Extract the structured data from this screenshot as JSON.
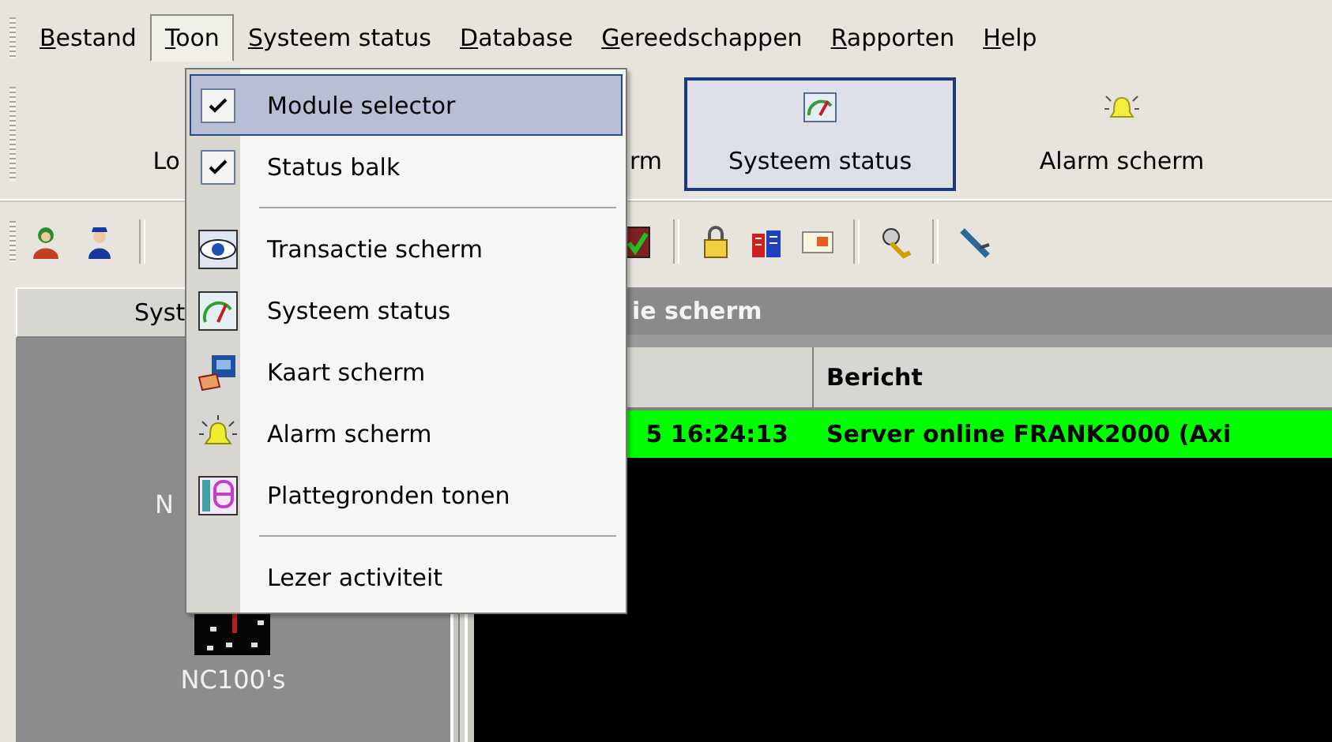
{
  "menu_bar": [
    {
      "label": "Bestand",
      "selected": false
    },
    {
      "label": "Toon",
      "selected": true
    },
    {
      "label": "Systeem status",
      "selected": false
    },
    {
      "label": "Database",
      "selected": false
    },
    {
      "label": "Gereedschappen",
      "selected": false
    },
    {
      "label": "Rapporten",
      "selected": false
    },
    {
      "label": "Help",
      "selected": false
    }
  ],
  "dropdown": [
    {
      "kind": "item",
      "label": "Module selector",
      "checked": true,
      "selected": true
    },
    {
      "kind": "item",
      "label": "Status balk",
      "checked": true,
      "selected": false
    },
    {
      "kind": "separator"
    },
    {
      "kind": "item",
      "label": "Transactie scherm",
      "checked": false,
      "selected": false
    },
    {
      "kind": "item",
      "label": "Systeem status",
      "checked": false,
      "selected": false
    },
    {
      "kind": "item",
      "label": "Kaart scherm",
      "checked": false,
      "selected": false
    },
    {
      "kind": "item",
      "label": "Alarm scherm",
      "checked": false,
      "selected": false
    },
    {
      "kind": "item",
      "label": "Plattegronden tonen",
      "checked": false,
      "selected": false
    },
    {
      "kind": "separator"
    },
    {
      "kind": "item",
      "label": "Lezer activiteit",
      "checked": false,
      "selected": false
    }
  ],
  "module_bar": [
    {
      "label": "Lo",
      "selected": false
    },
    {
      "label": "rm",
      "selected": false
    },
    {
      "label": "Systeem status",
      "selected": true
    },
    {
      "label": "Alarm scherm",
      "selected": false
    }
  ],
  "left_panel": {
    "header": "Syst",
    "items": [
      "N",
      "NC100's"
    ]
  },
  "event_panel": {
    "title": "ie scherm",
    "columns": [
      "",
      "Bericht"
    ],
    "rows": [
      {
        "cells": [
          "5 16:24:13",
          "Server online FRANK2000 (Axi"
        ],
        "color": "#00ff00"
      }
    ]
  }
}
